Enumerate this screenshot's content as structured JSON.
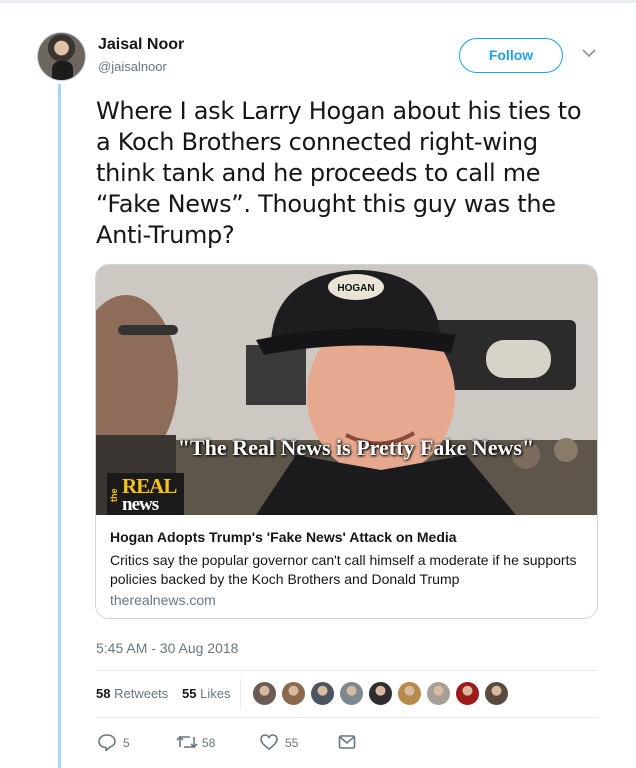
{
  "author": {
    "name": "Jaisal Noor",
    "handle": "@jaisalnoor"
  },
  "follow_label": "Follow",
  "tweet": {
    "lines": [
      "Where I ask Larry Hogan about his ties to",
      "a Koch Brothers connected right-wing",
      "think tank and he proceeds to call me",
      "“Fake News”. Thought this guy was the",
      "Anti-Trump?"
    ]
  },
  "card": {
    "image_quote": "\"The Real News is Pretty Fake News\"",
    "cap_text": "HOGAN",
    "logo": {
      "the": "the",
      "real": "REAL",
      "news": "news"
    },
    "title": "Hogan Adopts Trump's 'Fake News' Attack on Media",
    "description": "Critics say the popular governor can't call himself a moderate if he supports policies backed by the Koch Brothers and Donald Trump",
    "domain": "therealnews.com"
  },
  "timestamp": "5:45 AM - 30 Aug 2018",
  "stats": {
    "retweets_count": "58",
    "retweets_label": "Retweets",
    "likes_count": "55",
    "likes_label": "Likes"
  },
  "liker_avatars": [
    {
      "color": "#6b5a55"
    },
    {
      "color": "#8a6a4f"
    },
    {
      "color": "#4c5660"
    },
    {
      "color": "#7d8890"
    },
    {
      "color": "#2e2e2e"
    },
    {
      "color": "#b58a4a"
    },
    {
      "color": "#a7a09a"
    },
    {
      "color": "#9c1a1a"
    },
    {
      "color": "#5a4b40"
    }
  ],
  "actions": {
    "reply_count": "5",
    "retweet_count": "58",
    "like_count": "55"
  },
  "colors": {
    "accent": "#1da1f2",
    "thread_line": "#a6d7f5",
    "secondary_text": "#657786"
  }
}
